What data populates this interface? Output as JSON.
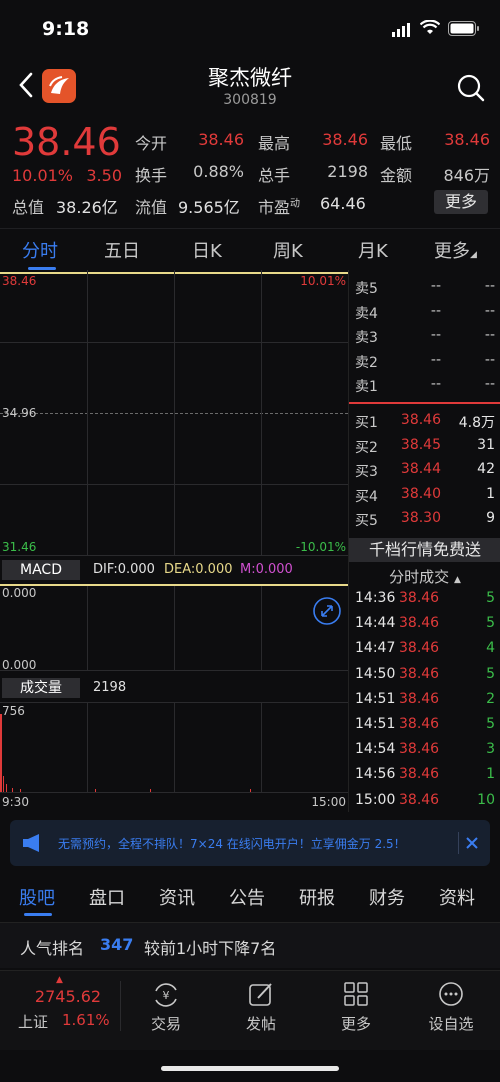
{
  "status_bar": {
    "time": "9:18"
  },
  "header": {
    "name": "聚杰微纤",
    "code": "300819"
  },
  "quote": {
    "price": "38.46",
    "change_pct": "10.01%",
    "change": "3.50",
    "rows": [
      [
        {
          "l": "今开",
          "v": "38.46",
          "c": "red"
        },
        {
          "l": "最高",
          "v": "38.46",
          "c": "red"
        },
        {
          "l": "最低",
          "v": "38.46",
          "c": "red"
        }
      ],
      [
        {
          "l": "换手",
          "v": "0.88%",
          "c": "gray"
        },
        {
          "l": "总手",
          "v": "2198",
          "c": "gray"
        },
        {
          "l": "金额",
          "v": "846万",
          "c": "gray"
        }
      ]
    ],
    "total_value_label": "总值",
    "total_value": "38.26亿",
    "float_value_label": "流值",
    "float_value": "9.565亿",
    "pe_label": "市盈",
    "pe_sup": "动",
    "pe_value": "64.46",
    "more_label": "更多"
  },
  "chart_tabs": [
    "分时",
    "五日",
    "日K",
    "周K",
    "月K",
    "更多"
  ],
  "chart": {
    "price_high": "38.46",
    "pct_high": "10.01%",
    "price_mid": "34.96",
    "price_low": "31.46",
    "pct_low": "-10.01%",
    "macd_label": "MACD",
    "dif": "DIF:0.000",
    "dea": "DEA:0.000",
    "m": "M:0.000",
    "macd_top": "0.000",
    "macd_bottom": "0.000",
    "volume_label": "成交量",
    "volume_value": "2198",
    "volume_max": "756",
    "time_start": "9:30",
    "time_end": "15:00"
  },
  "orderbook": {
    "asks": [
      {
        "label": "卖5",
        "price": "--",
        "vol": "--"
      },
      {
        "label": "卖4",
        "price": "--",
        "vol": "--"
      },
      {
        "label": "卖3",
        "price": "--",
        "vol": "--"
      },
      {
        "label": "卖2",
        "price": "--",
        "vol": "--"
      },
      {
        "label": "卖1",
        "price": "--",
        "vol": "--"
      }
    ],
    "bids": [
      {
        "label": "买1",
        "price": "38.46",
        "vol": "4.8万"
      },
      {
        "label": "买2",
        "price": "38.45",
        "vol": "31"
      },
      {
        "label": "买3",
        "price": "38.44",
        "vol": "42"
      },
      {
        "label": "买4",
        "price": "38.40",
        "vol": "1"
      },
      {
        "label": "买5",
        "price": "38.30",
        "vol": "9"
      }
    ],
    "promo": "千档行情免费送",
    "ticks_header": "分时成交",
    "ticks": [
      {
        "t": "14:36",
        "p": "38.46",
        "v": "5"
      },
      {
        "t": "14:44",
        "p": "38.46",
        "v": "5"
      },
      {
        "t": "14:47",
        "p": "38.46",
        "v": "4"
      },
      {
        "t": "14:50",
        "p": "38.46",
        "v": "5"
      },
      {
        "t": "14:51",
        "p": "38.46",
        "v": "2"
      },
      {
        "t": "14:51",
        "p": "38.46",
        "v": "5"
      },
      {
        "t": "14:54",
        "p": "38.46",
        "v": "3"
      },
      {
        "t": "14:56",
        "p": "38.46",
        "v": "1"
      },
      {
        "t": "15:00",
        "p": "38.46",
        "v": "10"
      }
    ]
  },
  "promo_banner": "无需预约，全程不排队！7×24 在线闪电开户！立享佣金万 2.5！",
  "bottom_tabs": [
    "股吧",
    "盘口",
    "资讯",
    "公告",
    "研报",
    "财务",
    "资料"
  ],
  "rank": {
    "label": "人气排名",
    "value": "347",
    "desc": "较前1小时下降7名"
  },
  "toolbar": {
    "index_value": "2745.62",
    "index_name": "上证",
    "index_pct": "1.61%",
    "items": [
      "交易",
      "发帖",
      "更多",
      "设自选"
    ]
  },
  "colors": {
    "up": "#e03a3a",
    "down": "#3bbd4a",
    "accent": "#3a7df0",
    "yellow_line": "#e8d98a"
  }
}
